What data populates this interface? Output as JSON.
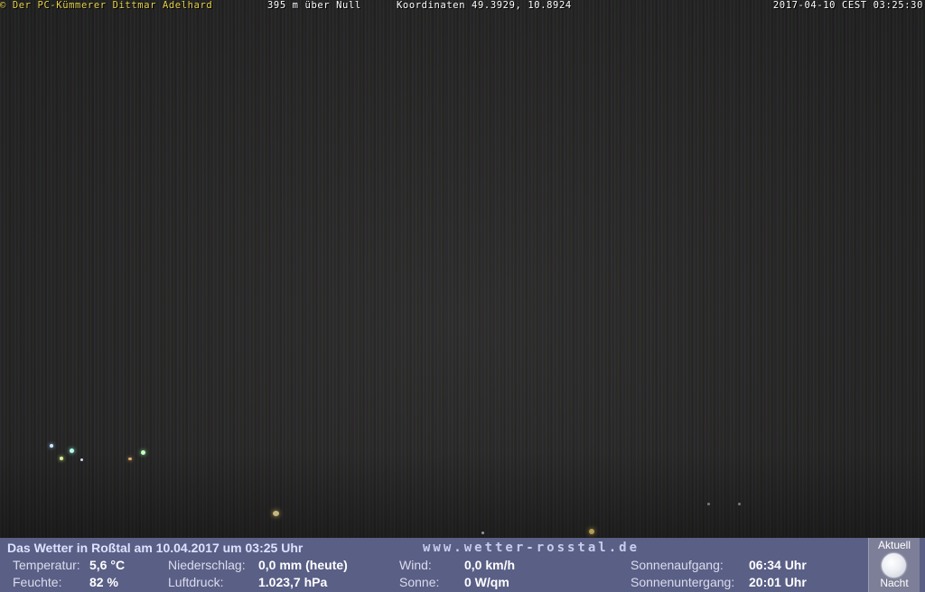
{
  "overlay": {
    "copyright": "© Der PC-Kümmerer Dittmar Adelhard",
    "altitude": "395 m über Null",
    "coordinates": "Koordinaten 49.3929, 10.8924",
    "timestamp": "2017-04-10 CEST 03:25:30"
  },
  "panel": {
    "title": "Das Wetter in Roßtal am 10.04.2017 um 03:25 Uhr",
    "website": "www.wetter-rosstal.de",
    "temperature_label": "Temperatur:",
    "temperature_value": "5,6 °C",
    "humidity_label": "Feuchte:",
    "humidity_value": "82 %",
    "precip_label": "Niederschlag:",
    "precip_value": "0,0 mm (heute)",
    "pressure_label": "Luftdruck:",
    "pressure_value": "1.023,7 hPa",
    "wind_label": "Wind:",
    "wind_value": "0,0 km/h",
    "sun_label": "Sonne:",
    "sun_value": "0 W/qm",
    "sunrise_label": "Sonnenaufgang:",
    "sunrise_value": "06:34 Uhr",
    "sunset_label": "Sonnenuntergang:",
    "sunset_value": "20:01 Uhr",
    "moon_top": "Aktuell",
    "moon_bottom": "Nacht"
  },
  "colors": {
    "panel_background": "#5a5f86",
    "copyright_text": "#e8d24a",
    "night_sky": "#232222"
  }
}
